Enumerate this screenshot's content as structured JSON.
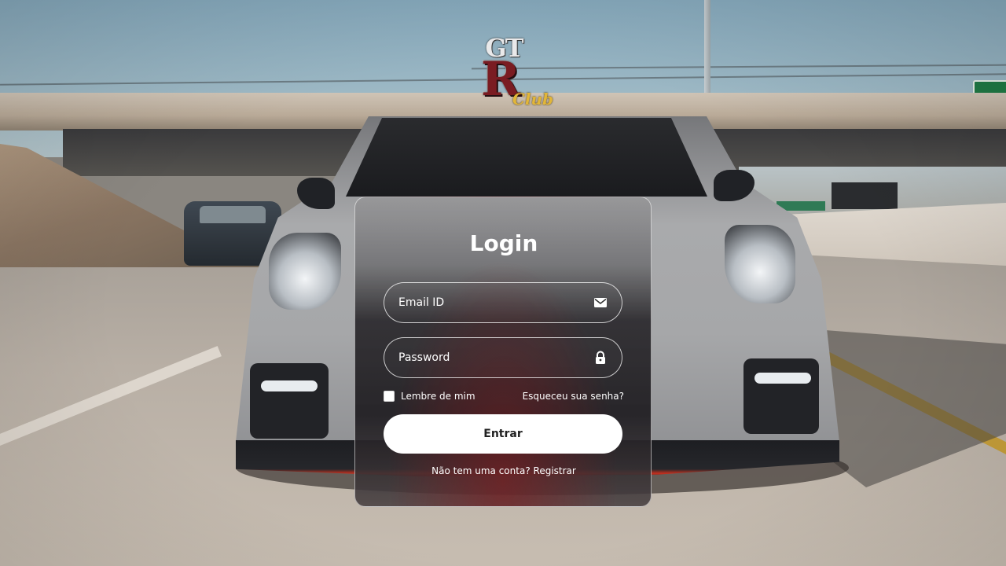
{
  "logo": {
    "line1": "GT",
    "line2": "R",
    "line3": "Club"
  },
  "login": {
    "title": "Login",
    "email_placeholder": "Email ID",
    "password_placeholder": "Password",
    "remember_label": "Lembre de mim",
    "forgot_label": "Esqueceu sua senha?",
    "submit_label": "Entrar",
    "register_prompt": "Não tem uma conta?",
    "register_link": "Registrar",
    "email_icon": "envelope-icon",
    "password_icon": "lock-icon"
  },
  "colors": {
    "accent_red": "#7a1c22",
    "logo_gold": "#e2b638",
    "button_bg": "#ffffff",
    "text": "#ffffff"
  }
}
